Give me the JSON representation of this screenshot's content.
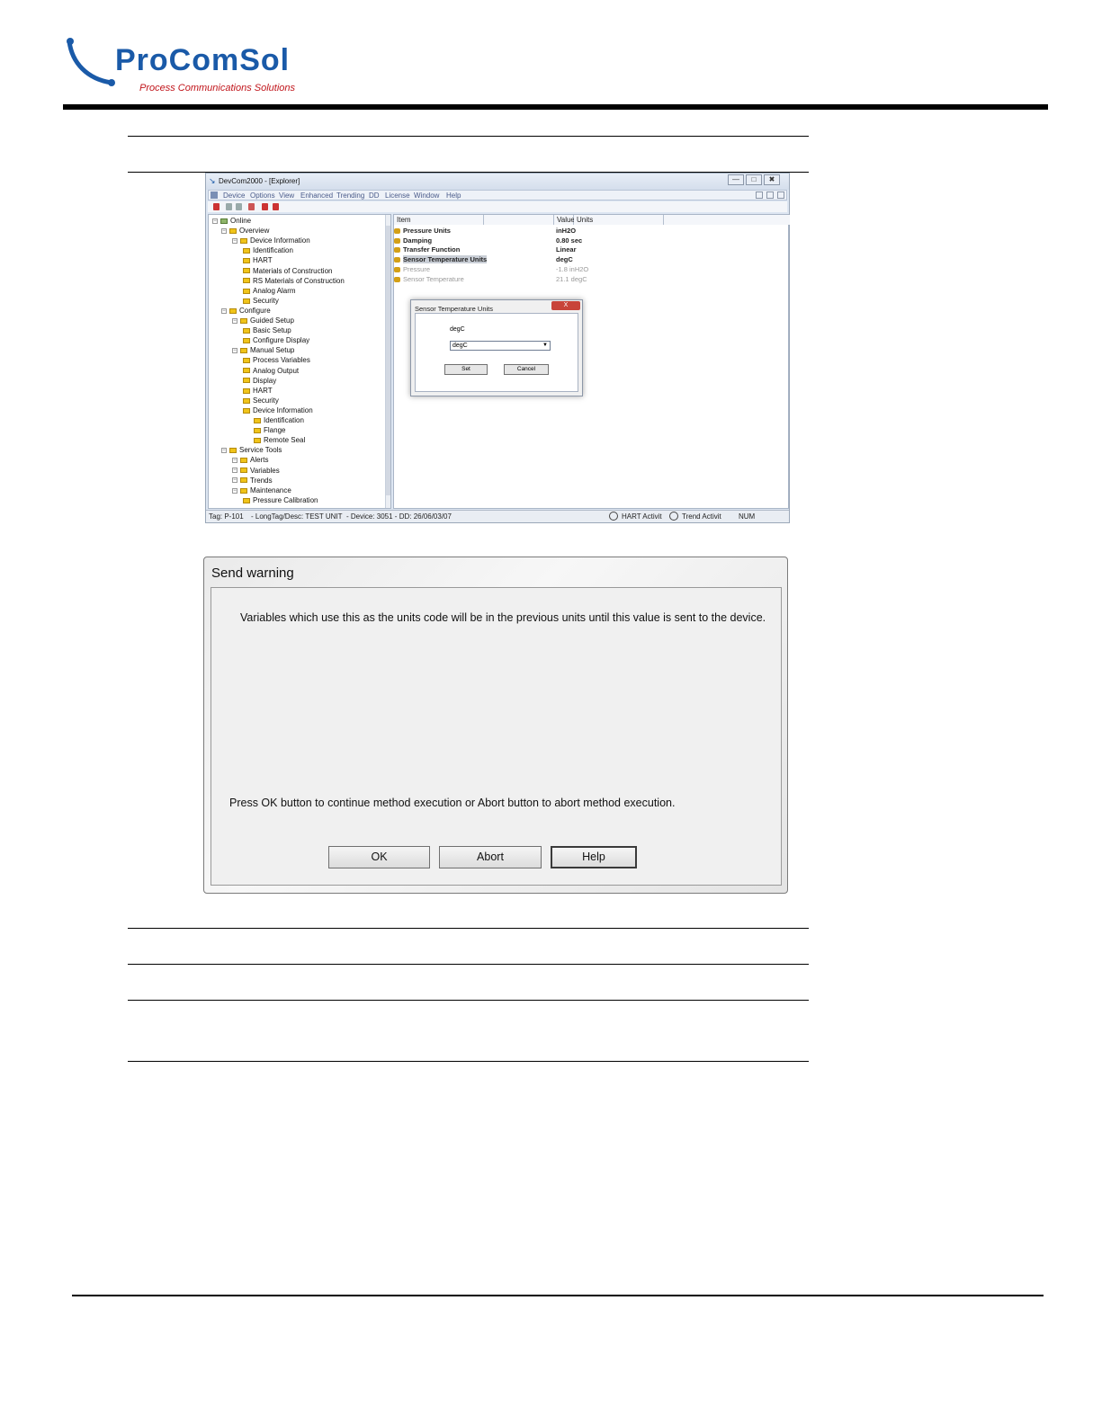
{
  "header": {
    "logo_main": "ProComSol",
    "logo_tagline": "Process Communications Solutions"
  },
  "devcom": {
    "title": "DevCom2000 - [Explorer]",
    "window_buttons": [
      "—",
      "□",
      "✖"
    ],
    "menus": [
      "Device",
      "Options",
      "View",
      "Enhanced",
      "Trending",
      "DD",
      "License",
      "Window",
      "Help"
    ],
    "tree": [
      {
        "label": "Online",
        "level": 0
      },
      {
        "label": "Overview",
        "level": 1
      },
      {
        "label": "Device Information",
        "level": 2
      },
      {
        "label": "Identification",
        "level": 3
      },
      {
        "label": "HART",
        "level": 3
      },
      {
        "label": "Materials of Construction",
        "level": 3
      },
      {
        "label": "RS Materials of Construction",
        "level": 3
      },
      {
        "label": "Analog Alarm",
        "level": 3
      },
      {
        "label": "Security",
        "level": 3
      },
      {
        "label": "Configure",
        "level": 1
      },
      {
        "label": "Guided Setup",
        "level": 2
      },
      {
        "label": "Basic Setup",
        "level": 3
      },
      {
        "label": "Configure Display",
        "level": 3
      },
      {
        "label": "Manual Setup",
        "level": 2
      },
      {
        "label": "Process Variables",
        "level": 3
      },
      {
        "label": "Analog Output",
        "level": 3
      },
      {
        "label": "Display",
        "level": 3
      },
      {
        "label": "HART",
        "level": 3
      },
      {
        "label": "Security",
        "level": 3
      },
      {
        "label": "Device Information",
        "level": 3
      },
      {
        "label": "Identification",
        "level": 4
      },
      {
        "label": "Flange",
        "level": 4
      },
      {
        "label": "Remote Seal",
        "level": 4
      },
      {
        "label": "Service Tools",
        "level": 1
      },
      {
        "label": "Alerts",
        "level": 2
      },
      {
        "label": "Variables",
        "level": 2
      },
      {
        "label": "Trends",
        "level": 2
      },
      {
        "label": "Maintenance",
        "level": 2
      },
      {
        "label": "Pressure Calibration",
        "level": 3
      }
    ],
    "columns": {
      "item": "Item",
      "value": "Value",
      "units": "Units"
    },
    "rows": [
      {
        "item": "Pressure Units",
        "value": "inH2O",
        "style": "bold"
      },
      {
        "item": "Damping",
        "value": "0.80 sec",
        "style": "bold"
      },
      {
        "item": "Transfer Function",
        "value": "Linear",
        "style": "bold"
      },
      {
        "item": "Sensor Temperature Units",
        "value": "degC",
        "style": "selected"
      },
      {
        "item": "Pressure",
        "value": "-1.8 inH2O",
        "style": "grey"
      },
      {
        "item": "Sensor Temperature",
        "value": "21.1 degC",
        "style": "grey"
      }
    ],
    "status": {
      "tag": "Tag: P-101",
      "longtag": "- LongTag/Desc: TEST UNIT",
      "device": "- Device: 3051 - DD: 26/06/03/07",
      "hart": "HART Activit",
      "trend": "Trend Activit",
      "num": "NUM"
    }
  },
  "sensor_dialog": {
    "title": "Sensor Temperature Units",
    "close": "X",
    "label": "degC",
    "selected": "degC",
    "set_label": "Set",
    "cancel_label": "Cancel"
  },
  "send_warning": {
    "title": "Send warning",
    "message": "Variables which use this as the units code will be in the previous units until this value is sent to the device.",
    "prompt": "Press OK button to continue method execution or Abort button to abort method execution.",
    "ok_label": "OK",
    "abort_label": "Abort",
    "help_label": "Help"
  },
  "colors": {
    "brand_blue": "#1a5aa8",
    "brand_red": "#c0141a",
    "folder_yellow": "#f0c419"
  }
}
